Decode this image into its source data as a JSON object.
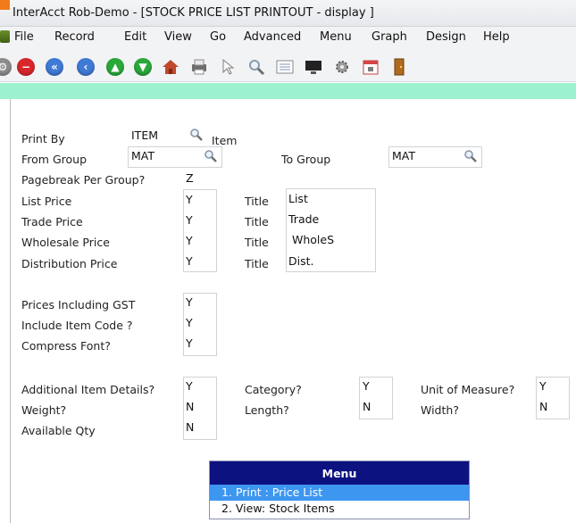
{
  "window": {
    "title": "InterAcct Rob-Demo - [STOCK PRICE LIST PRINTOUT - display ]"
  },
  "menubar": {
    "items": [
      "File",
      "Record",
      "Edit",
      "View",
      "Go",
      "Advanced",
      "Menu",
      "Graph",
      "Design",
      "Help"
    ]
  },
  "toolbar": {
    "buttons": [
      "settings-icon",
      "stop-icon",
      "first-record-icon",
      "previous-record-icon",
      "next-record-icon",
      "last-record-icon",
      "home-icon",
      "print-icon",
      "pointer-icon",
      "search-icon",
      "list-icon",
      "monitor-icon",
      "gear-icon",
      "calendar-icon",
      "exit-door-icon"
    ]
  },
  "colors": {
    "accent_bar": "#9cf1cf",
    "menu_header": "#0c1280",
    "menu_selected": "#3d96f0"
  },
  "form": {
    "print_by": {
      "label": "Print By",
      "value": "ITEM",
      "suffix": "Item"
    },
    "from_group": {
      "label": "From Group",
      "value": "MAT"
    },
    "to_group": {
      "label": "To Group",
      "value": "MAT"
    },
    "pagebreak": {
      "label": "Pagebreak Per Group?",
      "value": "Z"
    },
    "prices": [
      {
        "label": "List Price",
        "value": "Y",
        "title_label": "Title",
        "title_value": "List"
      },
      {
        "label": "Trade Price",
        "value": "Y",
        "title_label": "Title",
        "title_value": "Trade"
      },
      {
        "label": "Wholesale Price",
        "value": "Y",
        "title_label": "Title",
        "title_value": " WholeS"
      },
      {
        "label": "Distribution Price",
        "value": "Y",
        "title_label": "Title",
        "title_value": "Dist."
      }
    ],
    "options": [
      {
        "label": "Prices Including GST",
        "value": "Y"
      },
      {
        "label": "Include Item Code ?",
        "value": "Y"
      },
      {
        "label": "Compress Font?",
        "value": "Y"
      }
    ],
    "additional": [
      {
        "label": "Additional Item Details?",
        "value": "Y"
      },
      {
        "label": "Weight?",
        "value": "N"
      },
      {
        "label": "Available Qty",
        "value": "N"
      }
    ],
    "category": {
      "label": "Category?",
      "value": "Y"
    },
    "length": {
      "label": "Length?",
      "value": "N"
    },
    "unit_of_measure": {
      "label": "Unit of Measure?",
      "value": "Y"
    },
    "width": {
      "label": "Width?",
      "value": "N"
    }
  },
  "menu": {
    "header": "Menu",
    "options": [
      "1. Print : Price List",
      "2. View: Stock Items"
    ],
    "selected_index": 0
  }
}
